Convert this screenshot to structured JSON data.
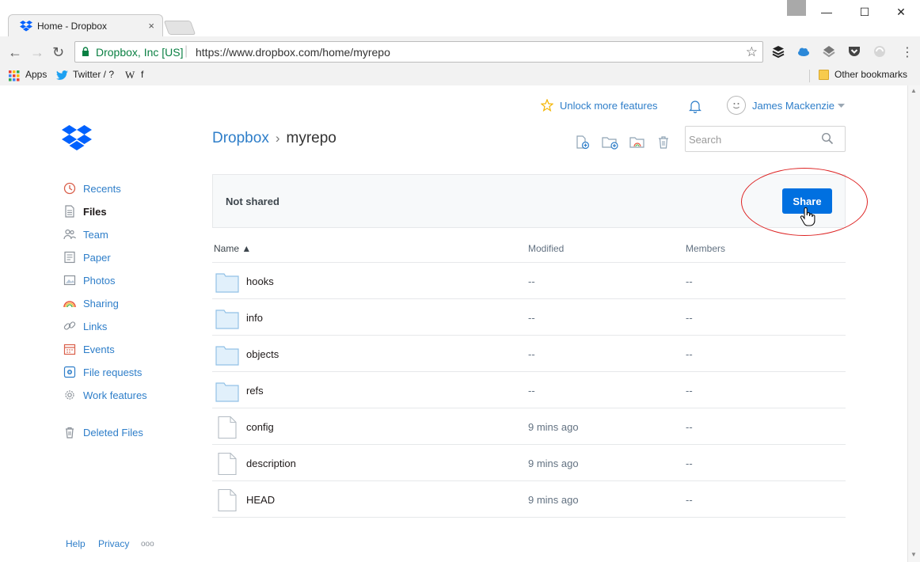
{
  "browser": {
    "tab_title": "Home - Dropbox",
    "tab_close": "×",
    "window_controls": {
      "minimize": "—",
      "maximize": "☐",
      "close": "✕"
    },
    "back": "←",
    "forward": "→",
    "reload": "↻",
    "site_identity": "Dropbox, Inc [US]",
    "url": "https://www.dropbox.com/home/myrepo",
    "bookmark_star": "☆",
    "menu": "⋮",
    "bookmarks": {
      "apps": "Apps",
      "twitter": "Twitter / ?",
      "wiki": "W",
      "facebook": "f",
      "other": "Other bookmarks"
    }
  },
  "top_bar": {
    "unlock_features": "Unlock more features",
    "user_name": "James Mackenzie"
  },
  "sidebar": {
    "items": [
      {
        "label": "Recents",
        "icon": "clock-icon"
      },
      {
        "label": "Files",
        "icon": "document-icon",
        "active": true
      },
      {
        "label": "Team",
        "icon": "people-icon"
      },
      {
        "label": "Paper",
        "icon": "paper-icon"
      },
      {
        "label": "Photos",
        "icon": "photo-icon"
      },
      {
        "label": "Sharing",
        "icon": "rainbow-icon"
      },
      {
        "label": "Links",
        "icon": "link-icon"
      },
      {
        "label": "Events",
        "icon": "calendar-icon"
      },
      {
        "label": "File requests",
        "icon": "file-request-icon"
      },
      {
        "label": "Work features",
        "icon": "gear-icon"
      },
      {
        "label": "Deleted Files",
        "icon": "trash-icon"
      }
    ],
    "footer": {
      "help": "Help",
      "privacy": "Privacy",
      "more": "ooo"
    }
  },
  "breadcrumb": {
    "root": "Dropbox",
    "separator": "›",
    "current": "myrepo"
  },
  "search": {
    "placeholder": "Search",
    "value": ""
  },
  "share_bar": {
    "status": "Not shared",
    "button": "Share"
  },
  "table": {
    "headers": {
      "name": "Name ▲",
      "modified": "Modified",
      "members": "Members"
    },
    "rows": [
      {
        "name": "hooks",
        "type": "folder",
        "modified": "--",
        "members": "--"
      },
      {
        "name": "info",
        "type": "folder",
        "modified": "--",
        "members": "--"
      },
      {
        "name": "objects",
        "type": "folder",
        "modified": "--",
        "members": "--"
      },
      {
        "name": "refs",
        "type": "folder",
        "modified": "--",
        "members": "--"
      },
      {
        "name": "config",
        "type": "file",
        "modified": "9 mins ago",
        "members": "--"
      },
      {
        "name": "description",
        "type": "file",
        "modified": "9 mins ago",
        "members": "--"
      },
      {
        "name": "HEAD",
        "type": "file",
        "modified": "9 mins ago",
        "members": "--"
      }
    ]
  },
  "colors": {
    "accent": "#2e7ec9",
    "share_button": "#0070e0",
    "highlight": "#dd2222"
  }
}
